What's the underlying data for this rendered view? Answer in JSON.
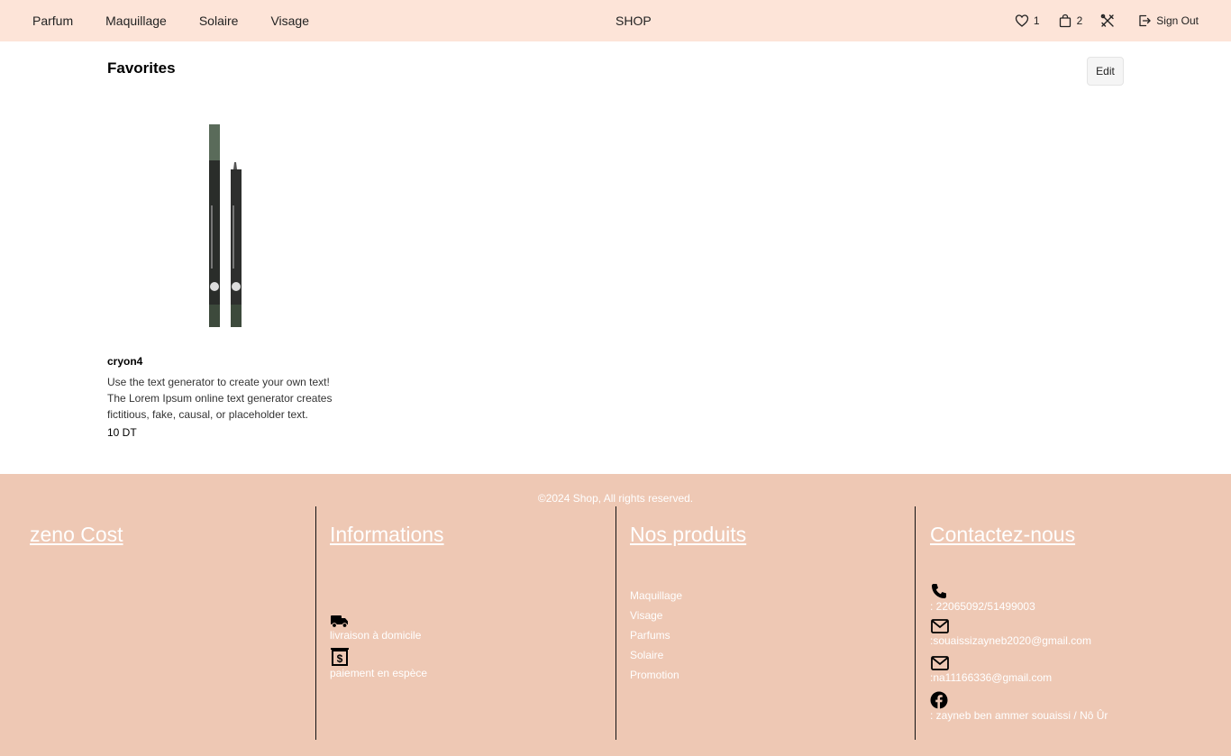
{
  "nav": {
    "links": [
      "Parfum",
      "Maquillage",
      "Solaire",
      "Visage"
    ],
    "brand": "SHOP",
    "favorites_count": "1",
    "cart_count": "2",
    "sign_out": "Sign Out"
  },
  "main": {
    "title": "Favorites",
    "edit_label": "Edit",
    "product": {
      "name": "cryon4",
      "description": "Use the text generator to create your own text! The Lorem Ipsum online text generator creates fictitious, fake, causal, or placeholder text.",
      "price": "10 DT"
    }
  },
  "footer": {
    "copyright": "©2024 Shop, All rights reserved.",
    "col1": {
      "title": "zeno Cost"
    },
    "col2": {
      "title": "Informations",
      "delivery": "livraison à domicile",
      "payment": "paiement en espèce"
    },
    "col3": {
      "title": "Nos produits",
      "items": [
        "Maquillage",
        "Visage",
        "Parfums",
        "Solaire",
        "Promotion"
      ]
    },
    "col4": {
      "title": "Contactez-nous",
      "phone": ": 22065092/51499003",
      "email1": ":souaissizayneb2020@gmail.com",
      "email2": ":na11166336@gmail.com",
      "facebook": ": zayneb ben ammer souaissi / Nô Ûr"
    }
  },
  "colors": {
    "header_bg": "#fde4d8",
    "footer_bg": "#eec8b4"
  },
  "icons": [
    "heart-icon",
    "bag-icon",
    "tools-icon",
    "sign-out-icon",
    "truck-icon",
    "cash-icon",
    "phone-icon",
    "mail-icon",
    "facebook-icon"
  ]
}
